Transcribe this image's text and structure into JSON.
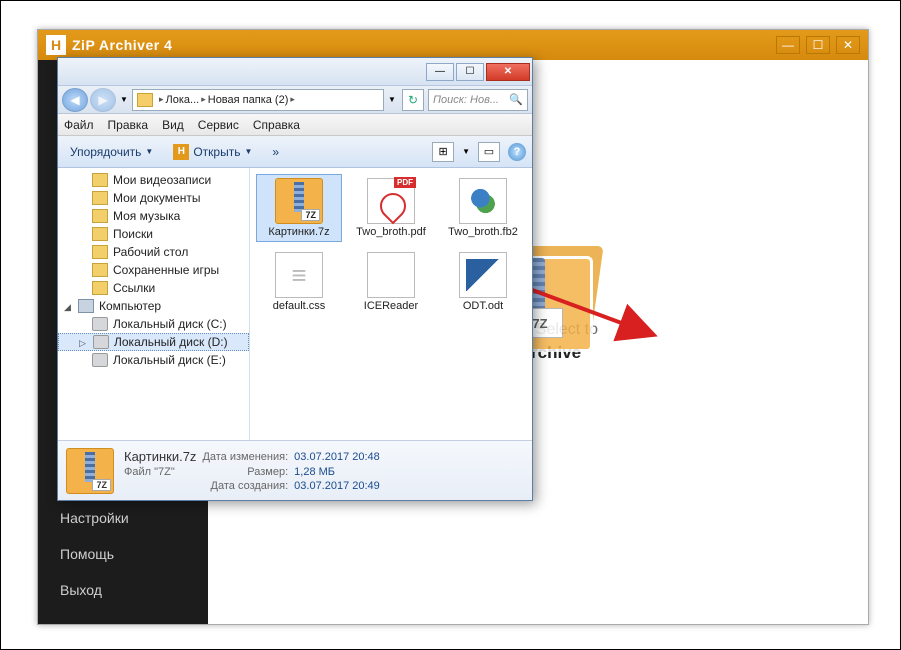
{
  "zip": {
    "logo": "H",
    "title": "ZiP Archiver 4",
    "winbtns": {
      "min": "—",
      "max": "☐",
      "close": "✕"
    },
    "sidebar": [
      "Настройки",
      "Помощь",
      "Выход"
    ],
    "drop_line1": "Drop or Select to",
    "drop_line2": "en Archive"
  },
  "ghost_tag": "7Z",
  "explorer": {
    "winbtns": {
      "min": "—",
      "max": "☐",
      "close": "✕"
    },
    "nav": {
      "back": "◀",
      "fwd": "▶",
      "drop": "▼",
      "refresh": "↻"
    },
    "breadcrumb": [
      "Лока...",
      "Новая папка (2)"
    ],
    "search_placeholder": "Поиск: Нов...",
    "search_icon": "🔍",
    "menu": [
      "Файл",
      "Правка",
      "Вид",
      "Сервис",
      "Справка"
    ],
    "toolbar": {
      "organize": "Упорядочить",
      "open": "Открыть",
      "chev": "»",
      "tri": "▼"
    },
    "tree": [
      {
        "label": "Мои видеозаписи",
        "icon": "folder",
        "lvl": 1
      },
      {
        "label": "Мои документы",
        "icon": "folder",
        "lvl": 1
      },
      {
        "label": "Моя музыка",
        "icon": "folder",
        "lvl": 1
      },
      {
        "label": "Поиски",
        "icon": "folder",
        "lvl": 1
      },
      {
        "label": "Рабочий стол",
        "icon": "folder",
        "lvl": 1
      },
      {
        "label": "Сохраненные игры",
        "icon": "folder",
        "lvl": 1
      },
      {
        "label": "Ссылки",
        "icon": "folder",
        "lvl": 1
      },
      {
        "label": "Компьютер",
        "icon": "comp",
        "lvl": 0,
        "expander": "◢"
      },
      {
        "label": "Локальный диск (C:)",
        "icon": "drive",
        "lvl": 1
      },
      {
        "label": "Локальный диск (D:)",
        "icon": "drive",
        "lvl": 1,
        "selected": true,
        "expander": "▷"
      },
      {
        "label": "Локальный диск (E:)",
        "icon": "drive",
        "lvl": 1
      }
    ],
    "files": [
      {
        "name": "Картинки.7z",
        "icon": "sevenz",
        "selected": true
      },
      {
        "name": "Two_broth.pdf",
        "icon": "pdf"
      },
      {
        "name": "Two_broth.fb2",
        "icon": "fb2"
      },
      {
        "name": "default.css",
        "icon": "css"
      },
      {
        "name": "ICEReader",
        "icon": "generic"
      },
      {
        "name": "ODT.odt",
        "icon": "odt"
      }
    ],
    "details": {
      "name": "Картинки.7z",
      "type": "Файл \"7Z\"",
      "mod_label": "Дата изменения:",
      "mod_value": "03.07.2017 20:48",
      "size_label": "Размер:",
      "size_value": "1,28 МБ",
      "created_label": "Дата создания:",
      "created_value": "03.07.2017 20:49"
    }
  }
}
